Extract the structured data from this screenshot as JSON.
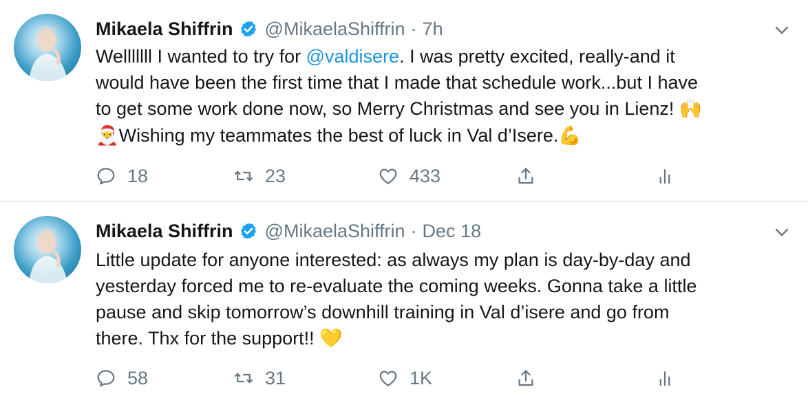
{
  "tweets": [
    {
      "name": "Mikaela Shiffrin",
      "handle": "@MikaelaShiffrin",
      "separator": "·",
      "time": "7h",
      "text": {
        "l1_a": "Welllllll I wanted to try for ",
        "l1_mention": "@valdisere",
        "l1_b": ". I was pretty excited, really-and it",
        "l2": "would have been the first time that I made that schedule work...but I have",
        "l3_a": "to get some work done now, so Merry Christmas and see you in Lienz! ",
        "l3_emoji": "🙌",
        "l4_emoji": "🎅",
        "l4_text": "Wishing my teammates the best of luck in Val d’Isere.",
        "l4_emoji2": "💪"
      },
      "replies": "18",
      "retweets": "23",
      "likes": "433"
    },
    {
      "name": "Mikaela Shiffrin",
      "handle": "@MikaelaShiffrin",
      "separator": "·",
      "time": "Dec 18",
      "text": {
        "l1": "Little update for anyone interested: as always my plan is day-by-day and",
        "l2": "yesterday forced me to re-evaluate the coming weeks. Gonna take a little",
        "l3": "pause and skip tomorrow’s downhill training in Val d’isere and go from",
        "l4": "there. Thx for the support!! ",
        "l4_emoji": "💛"
      },
      "replies": "58",
      "retweets": "31",
      "likes": "1K"
    }
  ],
  "icons": {
    "verified": "verified-badge-icon",
    "caret": "chevron-down-icon",
    "reply": "reply-icon",
    "retweet": "retweet-icon",
    "like": "heart-icon",
    "share": "share-icon",
    "analytics": "analytics-icon"
  },
  "colors": {
    "link": "#1b95e0",
    "secondary_text": "#657786",
    "divider": "#e6ecf0",
    "verified": "#1da1f2"
  }
}
